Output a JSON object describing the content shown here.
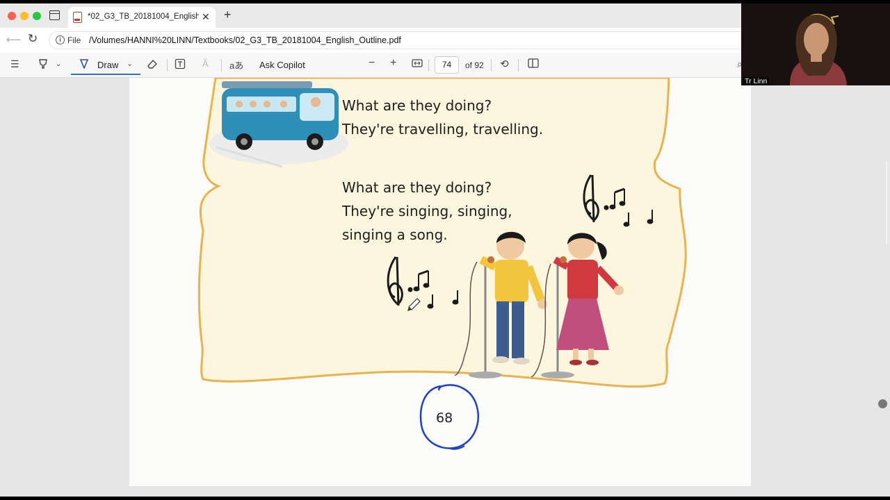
{
  "window": {
    "tab_title": "*02_G3_TB_20181004_English_Outline.pdf",
    "new_tab_symbol": "+",
    "close_symbol": "✕"
  },
  "address": {
    "scheme": "File",
    "url": "/Volumes/HANNI%20LINN/Textbooks/02_G3_TB_20181004_English_Outline.pdf"
  },
  "toolbar": {
    "draw_label": "Draw",
    "ask_copilot_label": "Ask Copilot",
    "current_page": "74",
    "page_of": "of 92",
    "icons": [
      "contents-icon",
      "highlight-icon",
      "draw-pen-icon",
      "eraser-icon",
      "text-box-icon",
      "text-format-icon",
      "read-aloud-icon",
      "zoom-out-icon",
      "zoom-in-icon",
      "fit-page-icon",
      "rotate-icon",
      "page-view-icon"
    ]
  },
  "page": {
    "verse1": [
      "What are they doing?",
      "They're travelling, travelling."
    ],
    "verse2": [
      "What are they doing?",
      "They're singing, singing,",
      "singing a song."
    ],
    "page_number": "68",
    "annotation_color": "#1f3fc4",
    "frame_color": "#e9b24c"
  },
  "webcam": {
    "participant_name": "Tr Linn"
  }
}
